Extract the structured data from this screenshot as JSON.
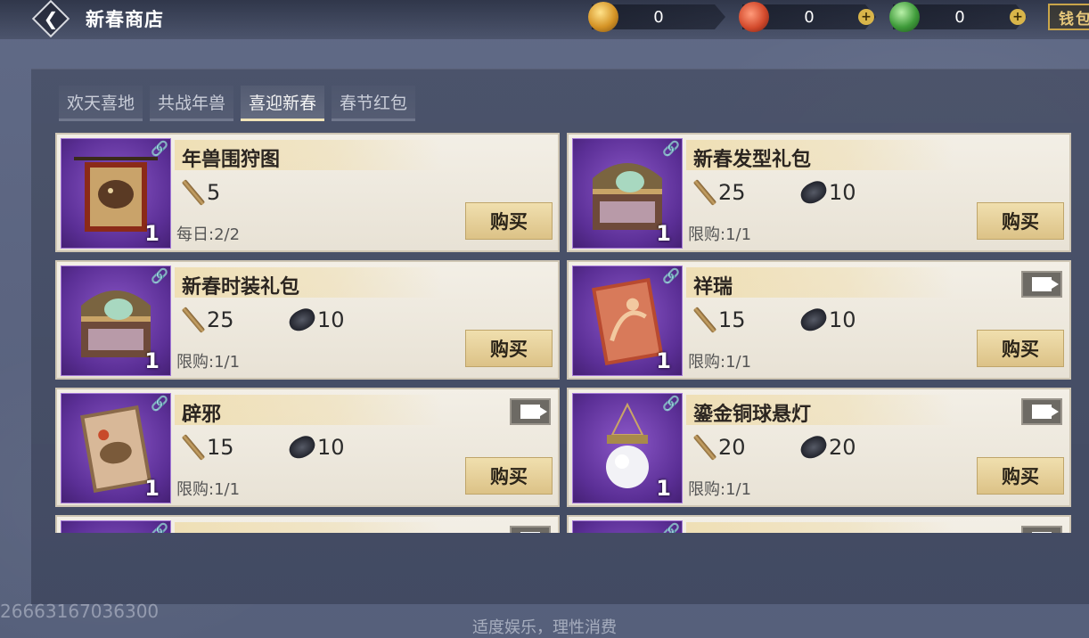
{
  "header": {
    "title": "新春商店",
    "currencies": [
      {
        "name": "gold-coin-icon",
        "value": "0"
      },
      {
        "name": "red-coin-icon",
        "value": "0"
      },
      {
        "name": "jade-coin-icon",
        "value": "0"
      }
    ],
    "wallet_label": "钱包"
  },
  "tabs": [
    {
      "label": "欢天喜地",
      "active": false
    },
    {
      "label": "共战年兽",
      "active": false
    },
    {
      "label": "喜迎新春",
      "active": true
    },
    {
      "label": "春节红包",
      "active": false
    }
  ],
  "items": [
    {
      "name": "年兽围狩图",
      "qty": "1",
      "cost1": "5",
      "cost2": "",
      "limit": "每日:2/2",
      "buy": "购买",
      "preview": false,
      "icon": "hunting-scroll-painting-icon"
    },
    {
      "name": "新春发型礼包",
      "qty": "1",
      "cost1": "25",
      "cost2": "10",
      "limit": "限购:1/1",
      "buy": "购买",
      "preview": false,
      "icon": "treasure-chest-icon"
    },
    {
      "name": "新春时装礼包",
      "qty": "1",
      "cost1": "25",
      "cost2": "10",
      "limit": "限购:1/1",
      "buy": "购买",
      "preview": false,
      "icon": "treasure-chest-icon"
    },
    {
      "name": "祥瑞",
      "qty": "1",
      "cost1": "15",
      "cost2": "10",
      "limit": "限购:1/1",
      "buy": "购买",
      "preview": true,
      "icon": "auspicious-painting-icon"
    },
    {
      "name": "辟邪",
      "qty": "1",
      "cost1": "15",
      "cost2": "10",
      "limit": "限购:1/1",
      "buy": "购买",
      "preview": true,
      "icon": "bixie-painting-icon"
    },
    {
      "name": "鎏金铜球悬灯",
      "qty": "1",
      "cost1": "20",
      "cost2": "20",
      "limit": "限购:1/1",
      "buy": "购买",
      "preview": true,
      "icon": "hanging-lantern-icon"
    },
    {
      "name": "",
      "qty": "",
      "cost1": "",
      "cost2": "",
      "limit": "",
      "buy": "",
      "preview": true,
      "icon": "partial-item-icon"
    },
    {
      "name": "",
      "qty": "",
      "cost1": "",
      "cost2": "",
      "limit": "",
      "buy": "",
      "preview": true,
      "icon": "partial-item-icon"
    }
  ],
  "watermark": "26663167036300",
  "footer": "适度娱乐，理性消费"
}
